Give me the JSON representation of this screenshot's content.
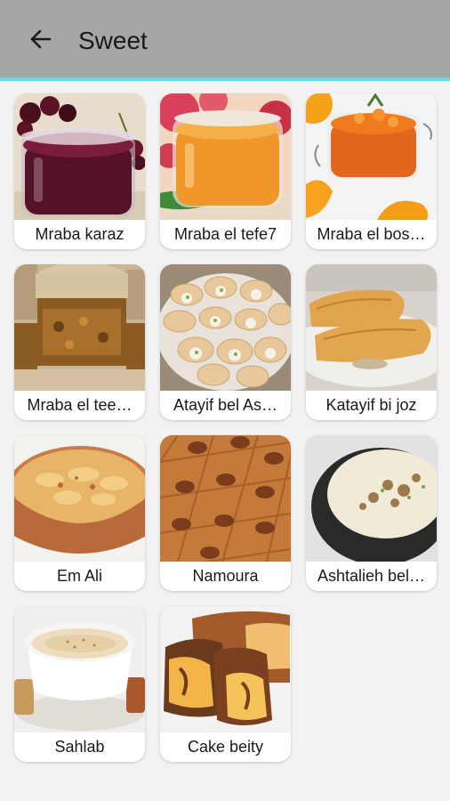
{
  "header": {
    "title": "Sweet",
    "back_icon": "arrow-left-icon"
  },
  "colors": {
    "appbar": "#a6a6a6",
    "accent_line": "#5be0e8",
    "background": "#f2f2f2"
  },
  "items": [
    {
      "label": "Mraba karaz"
    },
    {
      "label": "Mraba el tefe7"
    },
    {
      "label": "Mraba el bos…"
    },
    {
      "label": "Mraba el tee…"
    },
    {
      "label": "Atayif bel As…"
    },
    {
      "label": "Katayif bi joz"
    },
    {
      "label": "Em Ali"
    },
    {
      "label": "Namoura"
    },
    {
      "label": "Ashtalieh bel…"
    },
    {
      "label": "Sahlab"
    },
    {
      "label": "Cake beity"
    }
  ]
}
